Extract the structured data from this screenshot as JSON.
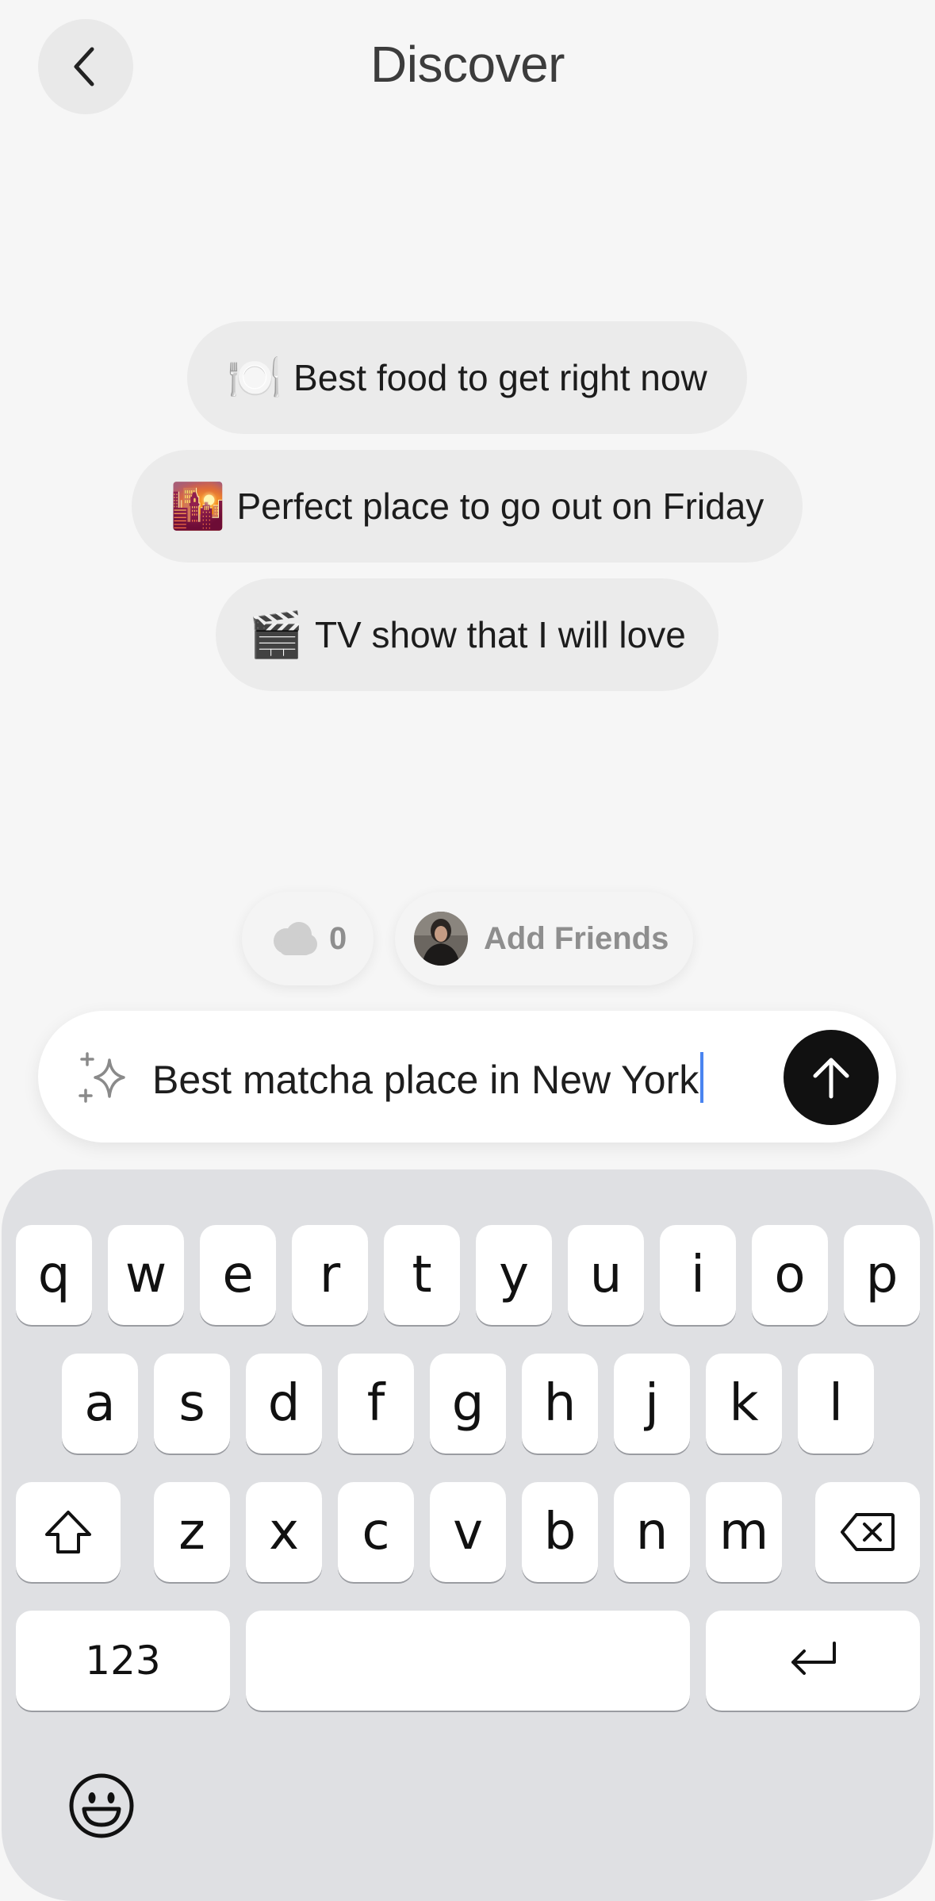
{
  "header": {
    "title": "Discover",
    "back_icon": "chevron-left-icon"
  },
  "suggestions": [
    {
      "emoji": "🍽️",
      "icon": "plate-icon",
      "label": "Best food to get right now"
    },
    {
      "emoji": "🌇",
      "icon": "city-sunset-icon",
      "label": "Perfect place to go out on Friday"
    },
    {
      "emoji": "🎬",
      "icon": "clapper-board-icon",
      "label": "TV show that I will love"
    }
  ],
  "social": {
    "cloud_count": "0",
    "add_friends_label": "Add Friends"
  },
  "composer": {
    "value": "Best matcha place in New York",
    "sparkle_icon": "sparkle-icon",
    "send_icon": "arrow-up-icon"
  },
  "keyboard": {
    "row1": [
      "q",
      "w",
      "e",
      "r",
      "t",
      "y",
      "u",
      "i",
      "o",
      "p"
    ],
    "row2": [
      "a",
      "s",
      "d",
      "f",
      "g",
      "h",
      "j",
      "k",
      "l"
    ],
    "row3": [
      "z",
      "x",
      "c",
      "v",
      "b",
      "n",
      "m"
    ],
    "numbers_label": "123",
    "space_label": "",
    "icons": {
      "shift": "shift-icon",
      "delete": "backspace-icon",
      "return": "return-icon",
      "emoji": "emoji-icon"
    }
  },
  "colors": {
    "background": "#f6f6f6",
    "chip": "#ebebeb",
    "send_button": "#111111",
    "keyboard": "#dfe0e3",
    "caret": "#4a84f0"
  }
}
